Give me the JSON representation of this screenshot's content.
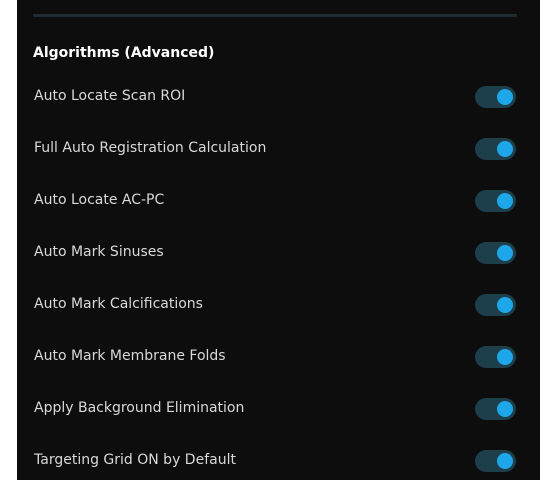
{
  "section": {
    "title": "Algorithms (Advanced)"
  },
  "settings": [
    {
      "label": "Auto Locate Scan ROI",
      "enabled": true
    },
    {
      "label": "Full Auto Registration Calculation",
      "enabled": true
    },
    {
      "label": "Auto Locate AC-PC",
      "enabled": true
    },
    {
      "label": "Auto Mark Sinuses",
      "enabled": true
    },
    {
      "label": "Auto Mark Calcifications",
      "enabled": true
    },
    {
      "label": "Auto Mark Membrane Folds",
      "enabled": true
    },
    {
      "label": "Apply Background Elimination",
      "enabled": true
    },
    {
      "label": "Targeting Grid ON by Default",
      "enabled": true
    }
  ],
  "colors": {
    "panel_background": "#0d0d0d",
    "toggle_track": "#1d3f4b",
    "toggle_knob": "#1ea7e8",
    "label_text": "#d9d9d9",
    "title_text": "#ffffff"
  }
}
